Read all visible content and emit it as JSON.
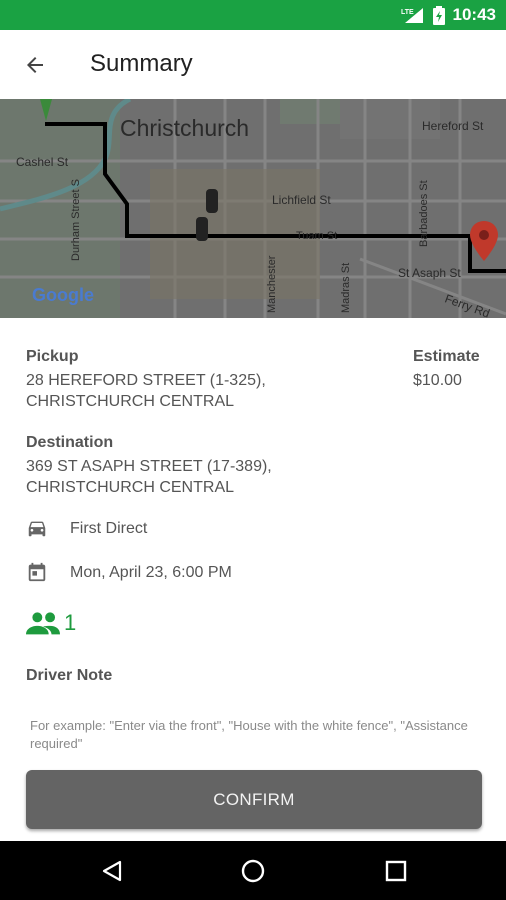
{
  "status_bar": {
    "network": "LTE",
    "time": "10:43",
    "color": "#1aa243"
  },
  "app_bar": {
    "title": "Summary",
    "back_icon": "arrow-left-icon"
  },
  "map": {
    "city_label": "Christchurch",
    "streets": [
      "Hereford St",
      "Cashel St",
      "Lichfield St",
      "Tuam St",
      "St Asaph St",
      "Ferry Rd",
      "Durham Street S",
      "Madras St",
      "Manchester",
      "Barbadoes St"
    ],
    "provider": "Google"
  },
  "trip": {
    "pickup_label": "Pickup",
    "pickup_line1": "28 HEREFORD STREET (1-325),",
    "pickup_line2": "CHRISTCHURCH CENTRAL",
    "estimate_label": "Estimate",
    "estimate_value": "$10.00",
    "destination_label": "Destination",
    "destination_line1": "369 ST ASAPH STREET (17-389),",
    "destination_line2": "CHRISTCHURCH CENTRAL",
    "vehicle": "First Direct",
    "datetime": "Mon, April 23, 6:00 PM",
    "passengers": "1",
    "accent_color": "#1e9b3e"
  },
  "driver_note": {
    "label": "Driver Note",
    "placeholder": "For example: \"Enter via the front\", \"House with the white fence\", \"Assistance required\""
  },
  "confirm": {
    "label": "CONFIRM"
  },
  "nav": {
    "back_icon": "triangle-back-icon",
    "home_icon": "circle-home-icon",
    "recents_icon": "square-recents-icon"
  }
}
